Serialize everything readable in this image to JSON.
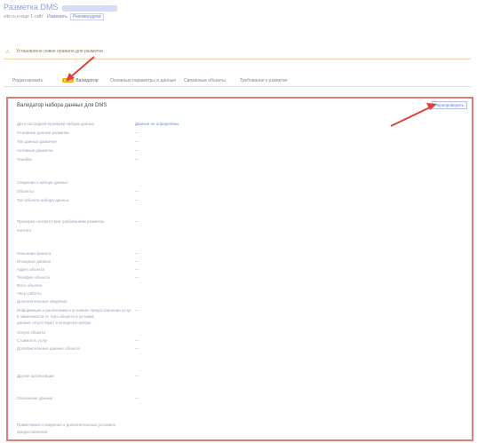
{
  "header": {
    "title": "Разметка DMS",
    "subtitle": "site.ru и еще 1 сайт",
    "subtitle_link": "Изменить",
    "badge": "Рекомендуем"
  },
  "notice": {
    "text": "Установлено новое правило для разметки"
  },
  "tabs": [
    {
      "label": "Редактировать"
    },
    {
      "label": "Валидатор",
      "badge": "NEW",
      "active": true
    },
    {
      "label": "Основные параметры и данные"
    },
    {
      "label": "Связанные объекты"
    },
    {
      "label": "Требования к разметке"
    }
  ],
  "panel": {
    "title": "Валидатор набора данных для DMS",
    "button": "Перепроверить"
  },
  "rows": [
    {
      "label": "Дата последней проверки набора данных",
      "value": "Данные не определены",
      "link": true
    },
    {
      "label": "Основные данные разметки",
      "value": "—"
    },
    {
      "label": "Тип данных разметки",
      "value": "—"
    },
    {
      "label": "Активные разметки",
      "value": "—"
    },
    {
      "label": "Ошибки",
      "value": "—"
    },
    {
      "label": "Сведения о наборе данных",
      "value": ""
    },
    {
      "label": "Объекты",
      "value": "—"
    },
    {
      "label": "Тип объекта набора данных",
      "value": "—"
    },
    {
      "label": "Проверка соответствия требованиям разметки",
      "value": "—"
    },
    {
      "label": "Контент",
      "value": ""
    },
    {
      "label": "Описание проекта",
      "value": "—"
    },
    {
      "label": "Исходные данные",
      "value": "—"
    },
    {
      "label": "Адрес объекта",
      "value": "—"
    },
    {
      "label": "Телефон объекта",
      "value": "—"
    },
    {
      "label": "Фото объекта",
      "value": ""
    },
    {
      "label": "Часы работы",
      "value": ""
    },
    {
      "label": "Дополнительные сведения",
      "value": ""
    },
    {
      "label": "Информация о расписании и условиях предоставления услуг",
      "value": "—"
    },
    {
      "label": "в зависимости от типа объекта и условий",
      "value": ""
    },
    {
      "label": "данные отсутствуют в исходном наборе",
      "value": ""
    },
    {
      "label": "Услуги объекта",
      "value": ""
    },
    {
      "label": "Стоимость услуг",
      "value": "—"
    },
    {
      "label": "Дополнительные данные объекта",
      "value": "—"
    },
    {
      "label": "Другие организации",
      "value": "—"
    },
    {
      "label": "Связанные данные",
      "value": "—"
    },
    {
      "label": "Примечания и сведения о дополнительных условиях",
      "value": ""
    },
    {
      "label": "предоставления",
      "value": ""
    }
  ]
}
